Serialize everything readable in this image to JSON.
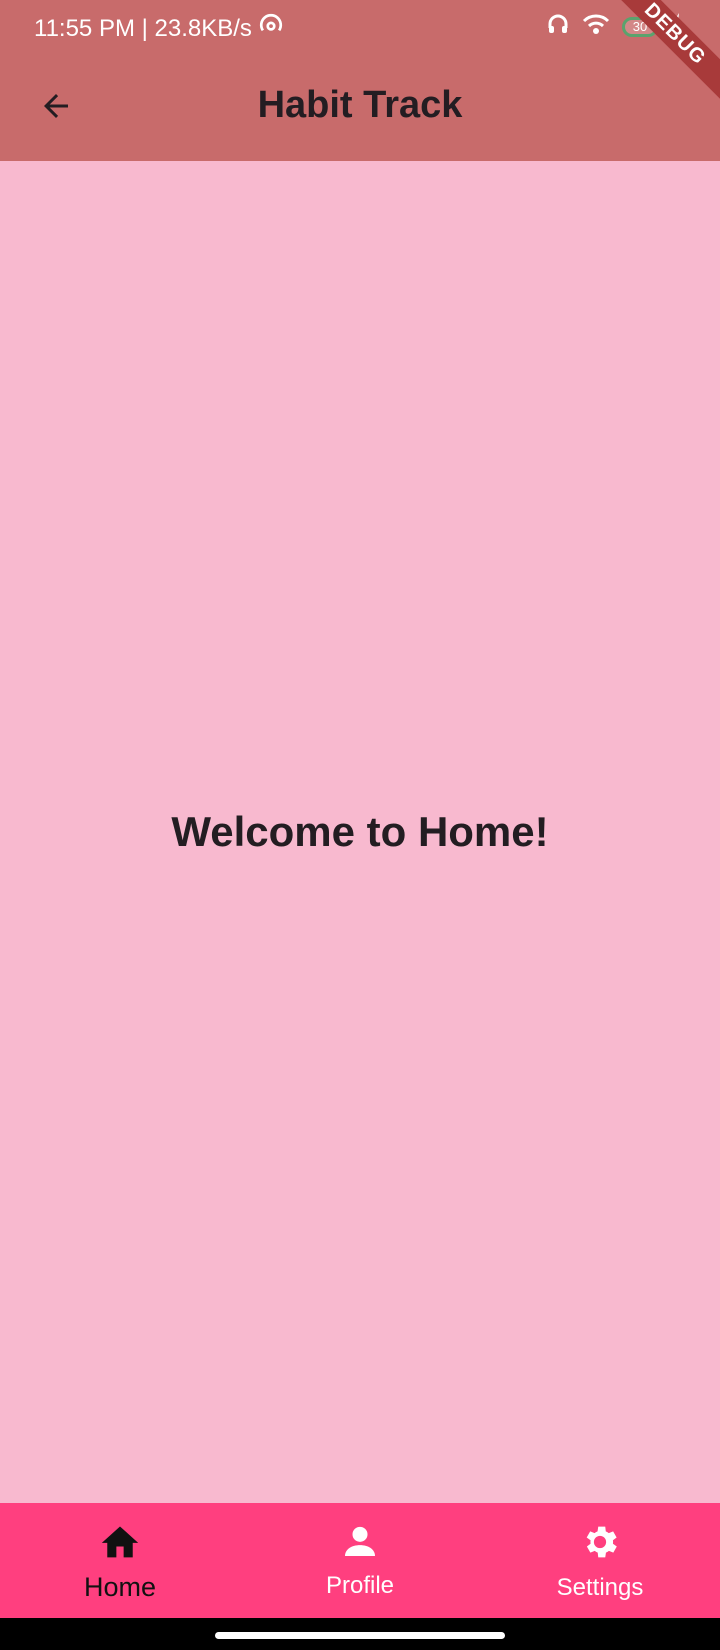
{
  "status_bar": {
    "time": "11:55 PM | 23.8KB/s",
    "battery_level": "30"
  },
  "app_bar": {
    "title": "Habit Track",
    "debug_label": "DEBUG"
  },
  "main": {
    "welcome_text": "Welcome to Home!"
  },
  "bottom_nav": {
    "items": [
      {
        "label": "Home",
        "icon": "home-icon",
        "active": true
      },
      {
        "label": "Profile",
        "icon": "person-icon",
        "active": false
      },
      {
        "label": "Settings",
        "icon": "gear-icon",
        "active": false
      }
    ]
  },
  "colors": {
    "app_bar": "#c86b6b",
    "background": "#f8b9cf",
    "bottom_nav": "#ff3f7f",
    "debug_ribbon": "#a83a3a"
  }
}
